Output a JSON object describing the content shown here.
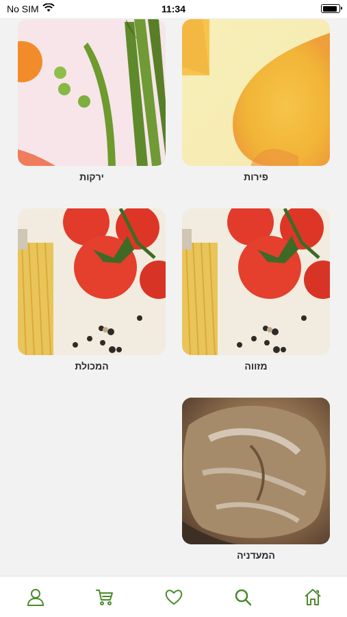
{
  "status": {
    "carrier": "No SIM",
    "time": "11:34"
  },
  "categories": [
    {
      "label": "פירות",
      "image": "mango-fruit"
    },
    {
      "label": "ירקות",
      "image": "asparagus-peas-vegetables"
    },
    {
      "label": "מזווה",
      "image": "tomatoes-pasta-pepper"
    },
    {
      "label": "המכולת",
      "image": "tomatoes-pasta-pepper"
    },
    {
      "label": "המעדניה",
      "image": "rustic-bread"
    }
  ],
  "tabbar": {
    "items": [
      "home-icon",
      "search-icon",
      "heart-icon",
      "cart-icon",
      "user-icon"
    ],
    "color": "#4a8a2a"
  }
}
